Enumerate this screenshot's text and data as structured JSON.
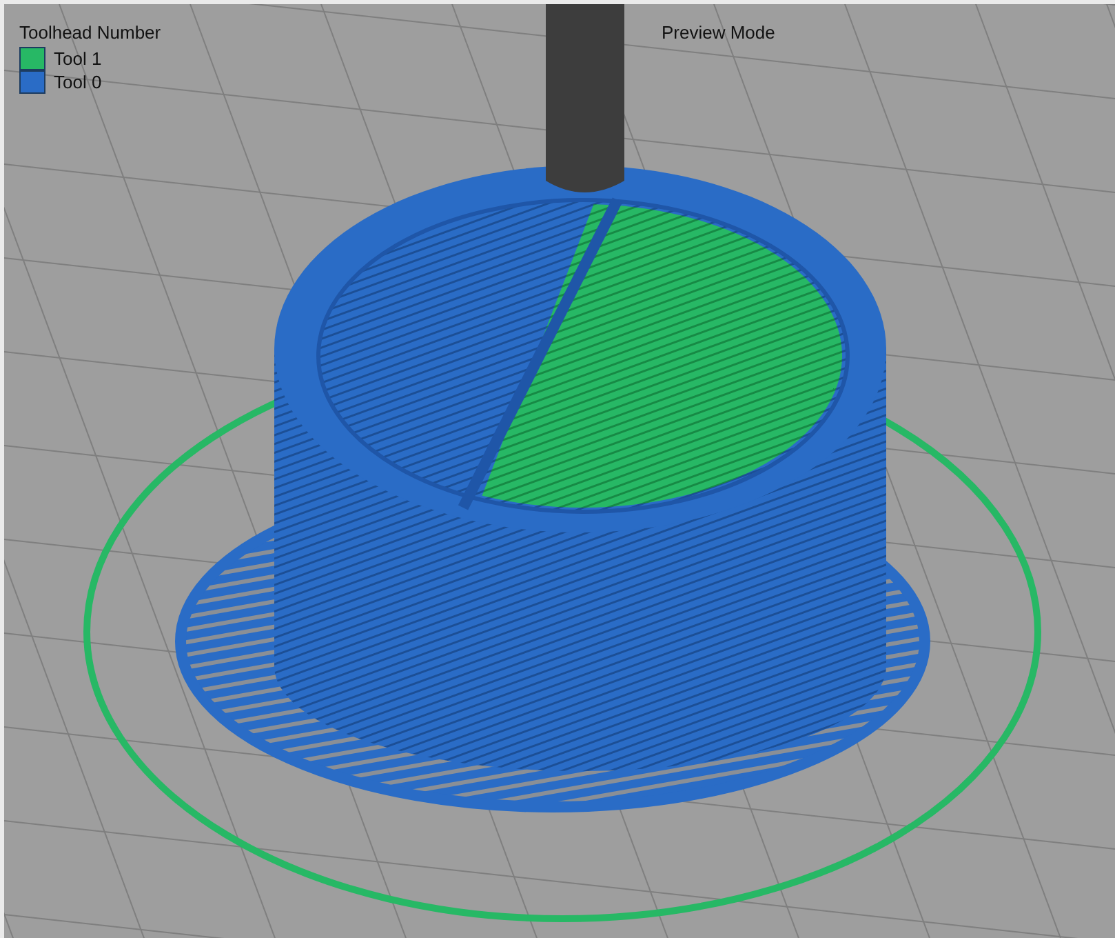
{
  "legend": {
    "title": "Toolhead Number",
    "items": [
      {
        "label": "Tool 1",
        "color": "#27b865"
      },
      {
        "label": "Tool 0",
        "color": "#2a6cc6"
      }
    ]
  },
  "mode_label": "Preview Mode"
}
